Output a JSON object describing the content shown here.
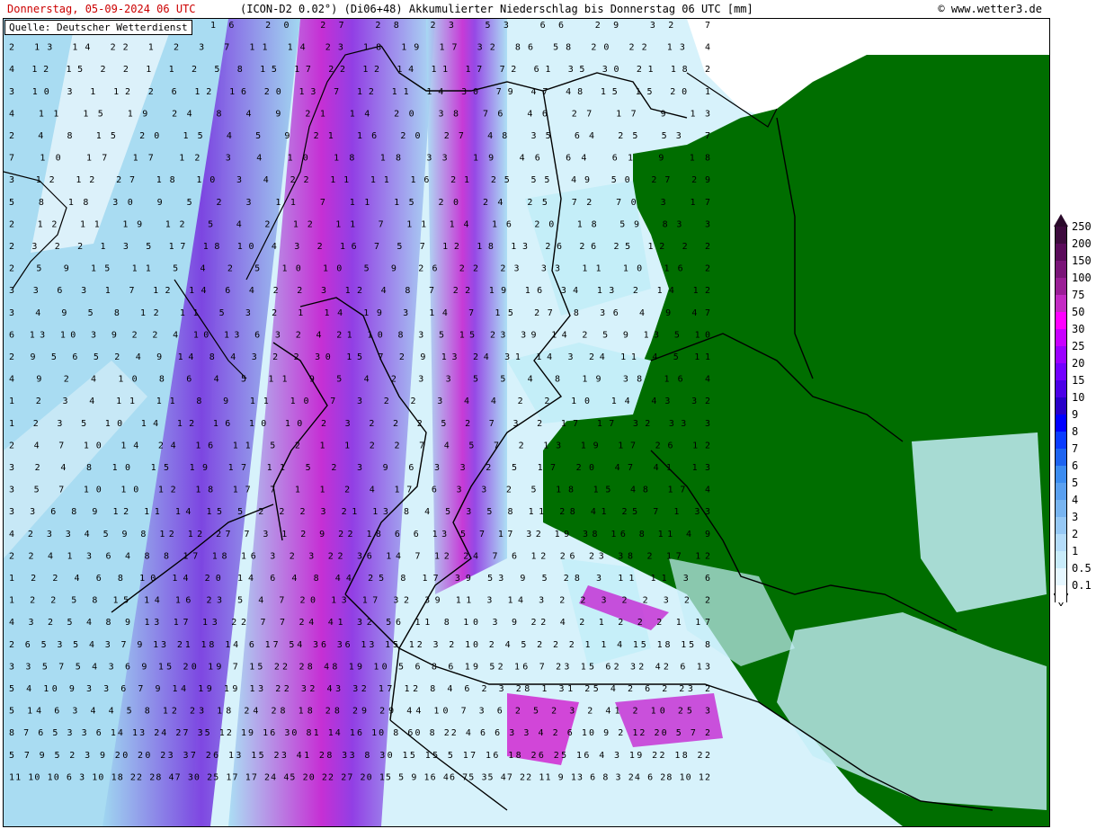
{
  "header": {
    "date": "Donnerstag, 05-09-2024   06 UTC",
    "model": "(ICON-D2 0.02°) (Di06+48)  Akkumulierter Niederschlag bis Donnerstag 06 UTC [mm]",
    "copyright": "© www.wetter3.de"
  },
  "source": "Quelle: Deutscher Wetterdienst",
  "colors": {
    "land_dry": "#006e00",
    "sea_white": "#ffffff",
    "light_blue": "#c4eef8",
    "mid_blue": "#6fbde8",
    "purple": "#8a2be2",
    "magenta": "#e000d0"
  },
  "legend": {
    "levels": [
      "250",
      "200",
      "150",
      "100",
      "75",
      "50",
      "30",
      "25",
      "20",
      "15",
      "10",
      "9",
      "8",
      "7",
      "6",
      "5",
      "4",
      "3",
      "2",
      "1",
      "0.5",
      "0.1"
    ],
    "colors": [
      "#3d0a3d",
      "#5a0a5a",
      "#7a1478",
      "#9a1e96",
      "#c32ac3",
      "#ff00ff",
      "#c800ff",
      "#9b00ff",
      "#7200ff",
      "#4b00e6",
      "#2800c8",
      "#0000ff",
      "#0a3cff",
      "#1e64f0",
      "#3c8cf0",
      "#5aa0f0",
      "#78b4f0",
      "#96c8f5",
      "#b4dcfa",
      "#c8ebfa",
      "#e6f7ff",
      "#ffffff"
    ]
  },
  "map_values": [
    {
      "t": "2 1 3 7 12 16 20 27 28 23 53 66 29 32 7"
    },
    {
      "t": "2 13 14 22 1 2 3 7 11 14 23 18 19 17 32 86 58 20 22 13 4"
    },
    {
      "t": "4 12 15 2 2 1 1 2 5 8 15 17 22 12 14 11 17 72 61 35 30 21 18 2"
    },
    {
      "t": "3 10 3 1 12 2 6 12 16 20 13 7 12 11 14 30 79 47 48 15 15 20 1"
    },
    {
      "t": "4 11 15 19 24 8 4 9 21 14 20 38 76 46 27 17 9 13"
    },
    {
      "t": "2 4 8 15 20 15 4 5 9 21 16 20 27 48 35 64 25 53 7"
    },
    {
      "t": "7 10 17 17 12 3 4 10 18 18 33 19 46 64 61 9 18"
    },
    {
      "t": "3 12 12 27 18 10 3 4 22 11 11 16 21 25 55 49 50 27 29"
    },
    {
      "t": "5 8 18 30 9 5 2 3 11 7 11 15 20 24 25 72 70 3 17"
    },
    {
      "t": "2 12 11 19 12 5 4 2 12 11 7 11 14 16 20 18 59 83 3"
    },
    {
      "t": "2 3 2 2 1 3 5 17 18 10 4 3 2 16 7 5 7 12 18 13 26 26 25 12 2 2"
    },
    {
      "t": "2 5 9 15 11 5 4 2 5 10 10 5 9 26 22 23 33 11 10 16 2"
    },
    {
      "t": "3 3 6 3 1 7 12 14 6 4 2 2 3 12 4 8 7 22 19 16 34 13 2 14 12"
    },
    {
      "t": "3 4 9 5 8 12 11 5 3 2 1 14 19 3 14 7 15 27 8 36 4 9 47"
    },
    {
      "t": "6 13 10 3 9 2 2 4 10 13 6 3 2 4 21 10 8 3 5 15 23 39 14 2 5 9 13 5 10"
    },
    {
      "t": "2 9 5 6 5 2 4 9 14 8 4 3 2 2 30 15 7 2 9 13 24 31 14 3 24 11 4 5 11"
    },
    {
      "t": "4 9 2 4 10 8 6 4 5 11 9 5 4 2 3 3 5 5 4 8 19 38 16 4"
    },
    {
      "t": "1 2 3 4 11 11 8 9 11 10 7 3 2 2 3 4 4 2 2 10 14 43 32"
    },
    {
      "t": "1 2 3 5 10 14 12 16 10 10 2 3 2 2 2 5 2 7 3 2 17 17 32 33 3"
    },
    {
      "t": "2 4 7 10 14 24 16 11 5 2 1 1 2 2 7 4 5 7 2 13 19 17 26 12"
    },
    {
      "t": "3 2 4 8 10 15 19 17 11 5 2 3 9 6 3 3 2 5 17 20 47 41 13"
    },
    {
      "t": "3 5 7 10 10 12 18 17 7 1 1 2 4 17 6 3 3 2 5 18 15 48 17 4"
    },
    {
      "t": "3 3 6 8 9 12 11 14 15 5 2 2 2 3 21 13 8 4 5 3 5 8 11 28 41 25 7 1 33"
    },
    {
      "t": "4 2 3 3 4 5 9 8 12 12 27 7 3 1 2 9 22 18 6 6 13 5 7 17 32 19 38 16 8 11 4 9"
    },
    {
      "t": "2 2 4 1 3 6 4 8 8 17 18 16 3 2 3 22 36 14 7 12 24 7 6 12 26 23 38 2 17 12"
    },
    {
      "t": "1 2 2 4 6 8 10 14 20 14 6 4 8 44 25 8 17 39 53 9 5 28 3 11 11 3 6"
    },
    {
      "t": "1 2 2 5 8 15 14 16 23 5 4 7 20 13 17 32 39 11 3 14 3 2 2 3 2 2 3 2 2"
    },
    {
      "t": "4 3 2 5 4 8 9 13 17 13 22 7 7 24 41 32 56 11 8 10 3 9 22 4 2 1 2 2 2 1 17"
    },
    {
      "t": "2 6 5 3 5 4 3 7 9 13 21 18 14 6 17 54 36 36 13 15 12 3 2 10 2 4 5 2 2 2 1 1 4 15 18 15 8"
    },
    {
      "t": "3 3 5 7 5 4 3 6 9 15 20 19 7 15 22 28 48 19 10 5 6 8 6 19 52 16 7 23 15 62 32 42 6 13"
    },
    {
      "t": "5 4 10 9 3 3 6 7 9 14 19 19 13 22 32 43 32 17 12 8 4 6 2 3 28 1 31 25 4 2 6 2 23 2"
    },
    {
      "t": "5 14 6 3 4 4 5 8 12 23 18 24 28 18 28 29 29 44 10 7 3 6 2 5 2 3 2 41 2 10 25 3"
    },
    {
      "t": "8 7 6 5 3 3 6 14 13 24 27 35 12 19 16 30 81 14 16 10 8 60 8 22 4 6 6 3 3 4 2 6 10 9 2 12 20 5 7 2"
    },
    {
      "t": "5 7 9 5 2 3 9 20 20 23 37 26 13 15 23 41 28 33 8 30 15 15 5 17 16 18 26 25 16 4 3 19 22 18 22"
    },
    {
      "t": "11 10 10 6 3 10 18 22 28 47 30 25 17 17 24 45 20 22 27 20 15 5 9 16 46 75 35 47 22 11 9 13 6 8 3 24 6 28 10 12"
    }
  ]
}
